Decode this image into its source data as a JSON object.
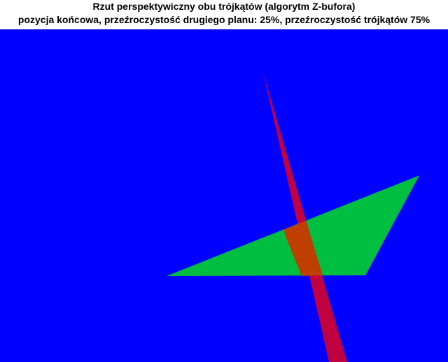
{
  "window": {
    "title_line_1": "Rzut perspektywiczny obu trójkątów (algorytm Z-bufora)",
    "title_line_2": "pozycja końcowa, przeźroczystość drugiego planu: 25%, przeźroczystość trójkątów 75%"
  },
  "scene": {
    "background_color": "#0000ff",
    "triangles": [
      {
        "name": "green-triangle",
        "color": "#00bf40"
      },
      {
        "name": "red-triangle",
        "color": "#c0003f"
      }
    ],
    "overlap_color": "#bf3f00",
    "background_transparency": "25%",
    "triangle_transparency": "75%"
  }
}
